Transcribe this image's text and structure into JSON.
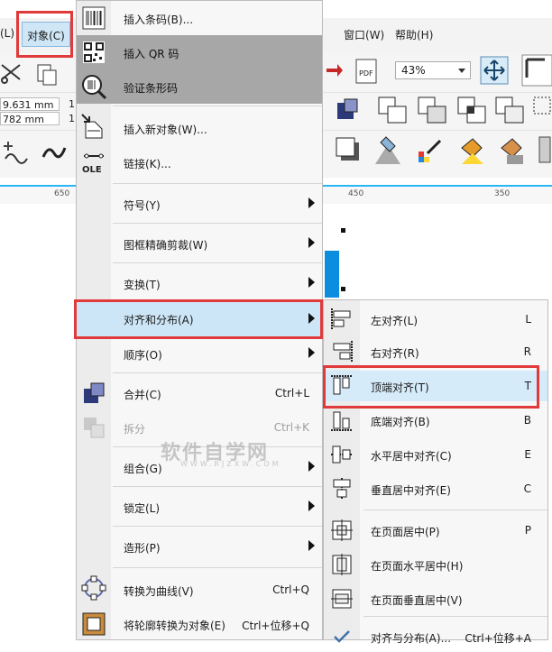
{
  "menubar": {
    "left_partial": "(L)",
    "object_menu": "对象(C)",
    "window_menu": "窗口(W)",
    "help_menu": "帮助(H)"
  },
  "toolbar": {
    "zoom_value": "43%"
  },
  "propbar": {
    "x_value": "9.631 mm",
    "y_value": "782 mm",
    "extra_a": "1",
    "extra_b": "1"
  },
  "ruler": {
    "labels": [
      "650",
      "450",
      "350"
    ]
  },
  "object_menu_items": [
    {
      "label": "插入条码(B)...",
      "icon": "barcode-icon"
    },
    {
      "label": "插入 QR 码",
      "icon": "qr-code-icon"
    },
    {
      "label": "验证条形码",
      "icon": "magnifier-barcode-icon"
    },
    {
      "label": "插入新对象(W)...",
      "icon": "insert-object-icon"
    },
    {
      "label": "链接(K)...",
      "icon": "ole-link-icon"
    },
    {
      "label": "符号(Y)"
    },
    {
      "label": "图框精确剪裁(W)"
    },
    {
      "label": "变换(T)"
    },
    {
      "label": "对齐和分布(A)"
    },
    {
      "label": "顺序(O)"
    },
    {
      "label": "合并(C)",
      "shortcut": "Ctrl+L",
      "icon": "combine-icon"
    },
    {
      "label": "拆分",
      "shortcut": "Ctrl+K",
      "icon": "break-apart-icon"
    },
    {
      "label": "组合(G)"
    },
    {
      "label": "锁定(L)"
    },
    {
      "label": "造形(P)"
    },
    {
      "label": "转换为曲线(V)",
      "shortcut": "Ctrl+Q",
      "icon": "convert-to-curve-icon"
    },
    {
      "label": "将轮廓转换为对象(E)",
      "shortcut": "Ctrl+位移+Q",
      "icon": "outline-to-object-icon"
    }
  ],
  "align_submenu_items": [
    {
      "label": "左对齐(L)",
      "shortcut": "L"
    },
    {
      "label": "右对齐(R)",
      "shortcut": "R"
    },
    {
      "label": "顶端对齐(T)",
      "shortcut": "T"
    },
    {
      "label": "底端对齐(B)",
      "shortcut": "B"
    },
    {
      "label": "水平居中对齐(C)",
      "shortcut": "E"
    },
    {
      "label": "垂直居中对齐(E)",
      "shortcut": "C"
    },
    {
      "label": "在页面居中(P)",
      "shortcut": "P"
    },
    {
      "label": "在页面水平居中(H)"
    },
    {
      "label": "在页面垂直居中(V)"
    },
    {
      "label": "对齐与分布(A)...",
      "shortcut": "Ctrl+位移+A"
    }
  ],
  "watermark": {
    "text": "软件自学网",
    "url": "WWW.RJZXW.COM"
  },
  "colors": {
    "highlight_red": "#e03a3a",
    "menu_bg": "#f7f7f7",
    "active_blue": "#cde6f7"
  }
}
